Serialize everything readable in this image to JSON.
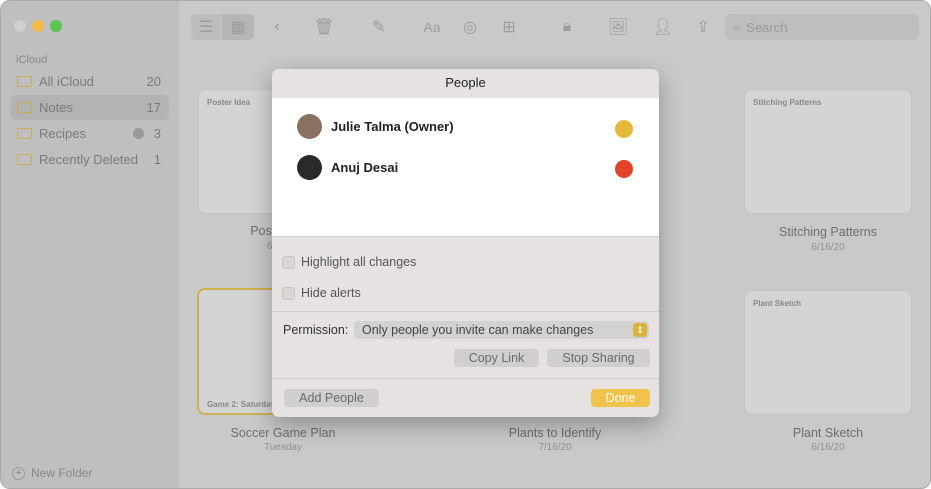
{
  "sidebar": {
    "section": "iCloud",
    "items": [
      {
        "label": "All iCloud",
        "count": "20"
      },
      {
        "label": "Notes",
        "count": "17"
      },
      {
        "label": "Recipes",
        "count": "3"
      },
      {
        "label": "Recently Deleted",
        "count": "1"
      }
    ],
    "new_folder": "New Folder"
  },
  "toolbar": {
    "search_placeholder": "Search",
    "font_label": "Aa"
  },
  "notes": [
    {
      "thumb_title": "Poster Idea",
      "label": "Pos",
      "date": "6,"
    },
    {
      "thumb_title": "Stitching Patterns",
      "label": "Stitching Patterns",
      "date": "6/16/20"
    },
    {
      "thumb_title": "Game 2: Saturday",
      "label": "Soccer Game Plan",
      "date": "Tuesday"
    },
    {
      "label": "Plants to Identify",
      "date": "7/16/20"
    },
    {
      "thumb_title": "Plant Sketch",
      "label": "Plant Sketch",
      "date": "6/16/20"
    }
  ],
  "dialog": {
    "title": "People",
    "people": [
      {
        "name": "Julie Talma (Owner)",
        "color": "#e4b83a"
      },
      {
        "name": "Anuj Desai",
        "color": "#e2432a"
      }
    ],
    "highlight": "Highlight all changes",
    "hide_alerts": "Hide alerts",
    "permission_label": "Permission:",
    "permission_value": "Only people you invite can make changes",
    "copy_link": "Copy Link",
    "stop_sharing": "Stop Sharing",
    "add_people": "Add People",
    "done": "Done"
  },
  "colors": {
    "accent": "#f0c44c"
  }
}
